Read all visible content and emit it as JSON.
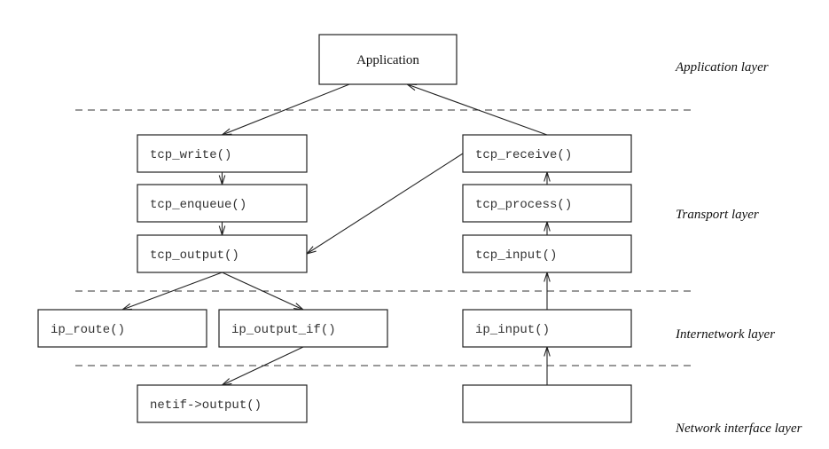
{
  "colors": {
    "line": "#222222",
    "text": "#333333",
    "background": "#ffffff"
  },
  "boxes": {
    "application": "Application",
    "tcp_write": "tcp_write()",
    "tcp_enqueue": "tcp_enqueue()",
    "tcp_output": "tcp_output()",
    "tcp_receive": "tcp_receive()",
    "tcp_process": "tcp_process()",
    "tcp_input": "tcp_input()",
    "ip_route": "ip_route()",
    "ip_output_if": "ip_output_if()",
    "ip_input": "ip_input()",
    "netif_output": "netif->output()",
    "netif_input": ""
  },
  "layers": {
    "application": "Application layer",
    "transport": "Transport layer",
    "internetwork": "Internetwork layer",
    "network_interface": "Network interface layer"
  },
  "edges": [
    {
      "from": "application",
      "to": "tcp_write"
    },
    {
      "from": "tcp_write",
      "to": "tcp_enqueue"
    },
    {
      "from": "tcp_enqueue",
      "to": "tcp_output"
    },
    {
      "from": "tcp_output",
      "to": "ip_route"
    },
    {
      "from": "tcp_output",
      "to": "ip_output_if"
    },
    {
      "from": "ip_output_if",
      "to": "netif_output"
    },
    {
      "from": "netif_input",
      "to": "ip_input"
    },
    {
      "from": "ip_input",
      "to": "tcp_input"
    },
    {
      "from": "tcp_input",
      "to": "tcp_process"
    },
    {
      "from": "tcp_process",
      "to": "tcp_receive"
    },
    {
      "from": "tcp_receive",
      "to": "application"
    },
    {
      "from": "tcp_receive",
      "to": "tcp_output"
    }
  ]
}
